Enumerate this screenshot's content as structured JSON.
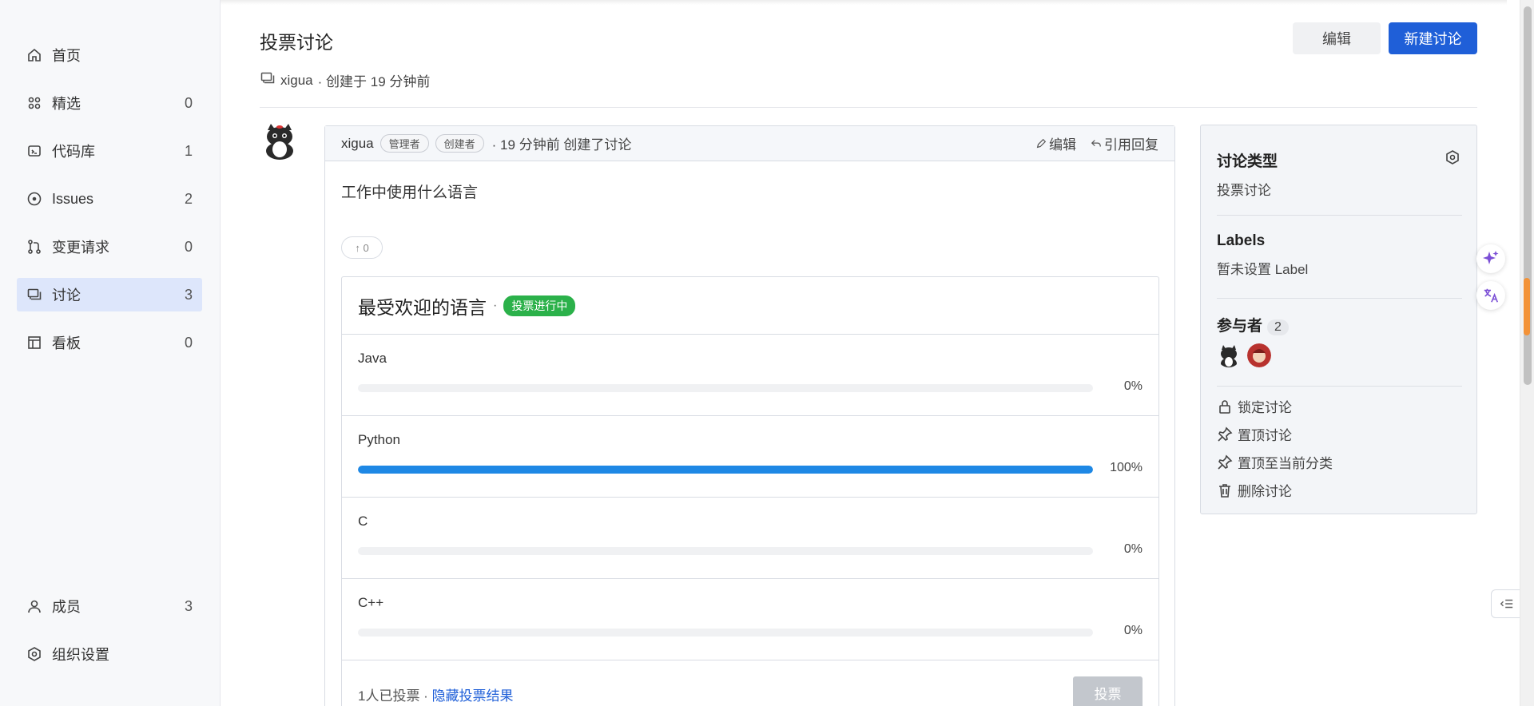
{
  "sidebar": {
    "items": [
      {
        "label": "首页",
        "count": "",
        "icon": "home-icon"
      },
      {
        "label": "精选",
        "count": "0",
        "icon": "grid-icon"
      },
      {
        "label": "代码库",
        "count": "1",
        "icon": "repo-icon"
      },
      {
        "label": "Issues",
        "count": "2",
        "icon": "issue-icon"
      },
      {
        "label": "变更请求",
        "count": "0",
        "icon": "merge-icon"
      },
      {
        "label": "讨论",
        "count": "3",
        "icon": "discussion-icon"
      },
      {
        "label": "看板",
        "count": "0",
        "icon": "board-icon"
      }
    ],
    "bottom": [
      {
        "label": "成员",
        "count": "3",
        "icon": "user-icon"
      },
      {
        "label": "组织设置",
        "count": "",
        "icon": "settings-icon"
      }
    ]
  },
  "header": {
    "title": "投票讨论",
    "edit_label": "编辑",
    "new_label": "新建讨论",
    "author": "xigua",
    "created": "· 创建于 19 分钟前"
  },
  "comment": {
    "author": "xigua",
    "tag_admin": "管理者",
    "tag_creator": "创建者",
    "time": "· 19 分钟前 创建了讨论",
    "action_edit": "编辑",
    "action_quote": "引用回复",
    "body": "工作中使用什么语言",
    "upvote": "↑ 0"
  },
  "poll": {
    "title": "最受欢迎的语言",
    "dot": "·",
    "status": "投票进行中",
    "options": [
      {
        "name": "Java",
        "pct": "0%",
        "fill": 0
      },
      {
        "name": "Python",
        "pct": "100%",
        "fill": 100
      },
      {
        "name": "C",
        "pct": "0%",
        "fill": 0
      },
      {
        "name": "C++",
        "pct": "0%",
        "fill": 0
      }
    ],
    "voted_text": "1人已投票 · ",
    "hide_link": "隐藏投票结果",
    "vote_button": "投票"
  },
  "panel": {
    "type_title": "讨论类型",
    "type_value": "投票讨论",
    "labels_title": "Labels",
    "labels_value": "暂未设置 Label",
    "participants_title": "参与者",
    "participants_count": "2",
    "actions": [
      {
        "label": "锁定讨论",
        "icon": "lock-icon"
      },
      {
        "label": "置顶讨论",
        "icon": "pin-icon"
      },
      {
        "label": "置顶至当前分类",
        "icon": "pin-category-icon"
      },
      {
        "label": "删除讨论",
        "icon": "trash-icon"
      }
    ]
  },
  "colors": {
    "primary": "#1f5fd8",
    "bar": "#1e88e5",
    "status_green": "#2bb14a",
    "active_nav": "#dde6fb"
  }
}
